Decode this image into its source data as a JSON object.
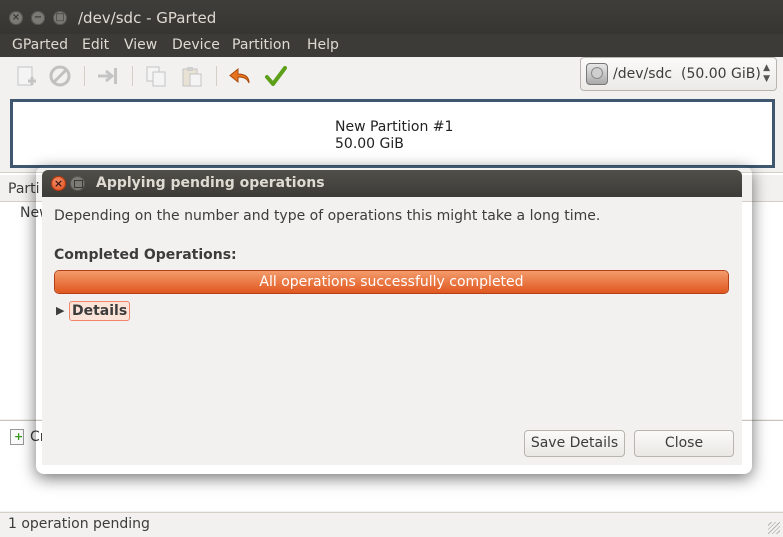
{
  "window": {
    "title": "/dev/sdc - GParted"
  },
  "menu": [
    "GParted",
    "Edit",
    "View",
    "Device",
    "Partition",
    "Help"
  ],
  "toolbar": {
    "icons": [
      "new-icon",
      "delete-icon",
      "resize-icon",
      "copy-icon",
      "paste-icon",
      "undo-icon",
      "apply-icon"
    ]
  },
  "device_selector": {
    "name": "/dev/sdc",
    "size": "(50.00 GiB)"
  },
  "partition_graphic": {
    "name": "New Partition #1",
    "size": "50.00 GiB"
  },
  "partition_list": {
    "column_header": "Parti",
    "first_row": "New"
  },
  "operations": {
    "first_op_partial": "Cr"
  },
  "statusbar": {
    "text": "1 operation pending"
  },
  "dialog": {
    "title": "Applying pending operations",
    "message": "Depending on the number and type of operations this might take a long time.",
    "completed_label": "Completed Operations:",
    "progress_text": "All operations successfully completed",
    "progress_fraction": 1.0,
    "details_label": "Details",
    "save_details_label": "Save Details",
    "close_label": "Close"
  },
  "colors": {
    "accent": "#e95420",
    "titlebar": "#3c3b37",
    "partition_border": "#3f5870"
  }
}
